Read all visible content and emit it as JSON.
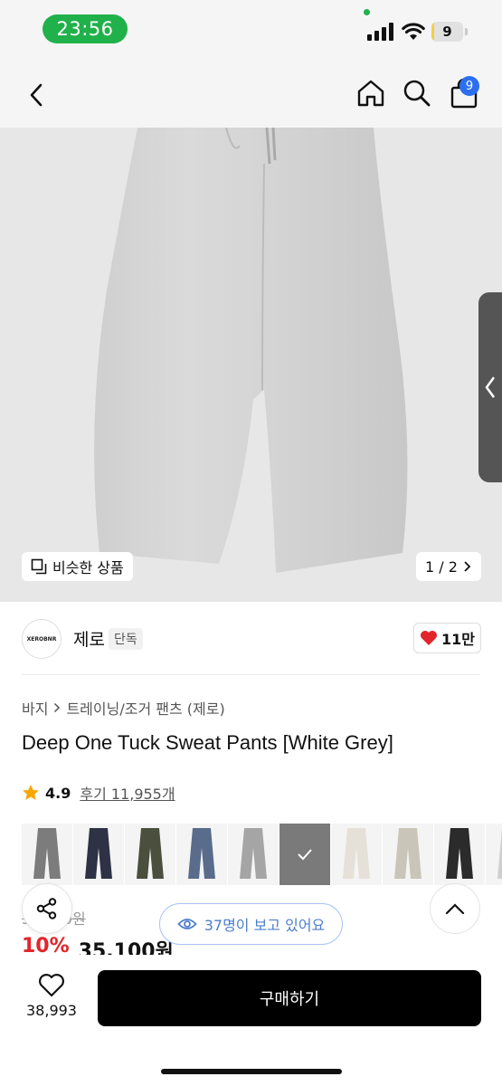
{
  "status_bar": {
    "time": "23:56",
    "battery": "9",
    "battery_level": 0.09
  },
  "header": {
    "cart_count": "9"
  },
  "product_image": {
    "similar_label": "비슷한 상품",
    "pager": "1 / 2"
  },
  "brand": {
    "logo_text": "XEROBNR",
    "name": "제로",
    "badge": "단독",
    "likes": "11만"
  },
  "breadcrumb": [
    "바지",
    "트레이닝/조거 팬츠 (제로)"
  ],
  "product": {
    "title": "Deep One Tuck Sweat Pants [White Grey]",
    "rating": "4.9",
    "reviews": "후기 11,955개",
    "original_price": "39,000원",
    "discount": "10%",
    "price": "35,100원"
  },
  "swatches": [
    {
      "color": "#7c7c7c"
    },
    {
      "color": "#2e3244"
    },
    {
      "color": "#4a4f3e"
    },
    {
      "color": "#5a6c8c"
    },
    {
      "color": "#a5a5a5"
    },
    {
      "color": "#d8d8d8",
      "selected": true
    },
    {
      "color": "#e6e1d8"
    },
    {
      "color": "#c9c5b8"
    },
    {
      "color": "#2b2b2b"
    },
    {
      "color": "#cfcfcf"
    }
  ],
  "viewers": "37명이 보고 있어요",
  "bottom": {
    "wish_count": "38,993",
    "buy_label": "구매하기"
  },
  "colors": {
    "accent": "#e3242b",
    "badge_blue": "#2b6ff0",
    "pill_border": "#a9c4f0",
    "time_pill": "#21b14b"
  }
}
